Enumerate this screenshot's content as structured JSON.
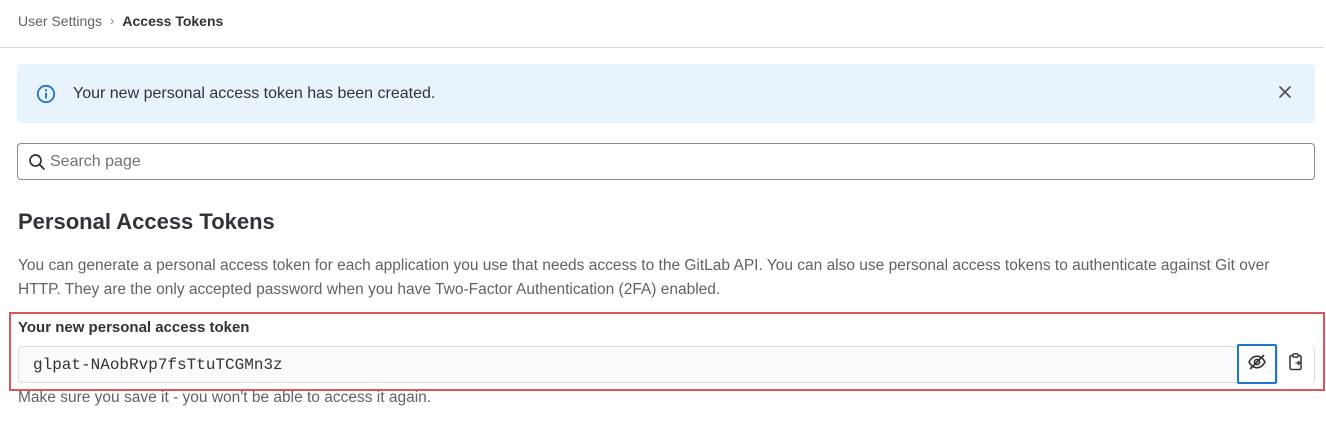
{
  "breadcrumb": {
    "parent": "User Settings",
    "separator": "›",
    "current": "Access Tokens"
  },
  "alert": {
    "message": "Your new personal access token has been created.",
    "icon": "info-icon",
    "close_icon": "close-icon",
    "color": "#e9f3fc",
    "icon_color": "#1f75cb"
  },
  "search": {
    "placeholder": "Search page",
    "value": ""
  },
  "section": {
    "title": "Personal Access Tokens",
    "description": "You can generate a personal access token for each application you use that needs access to the GitLab API. You can also use personal access tokens to authenticate against Git over HTTP. They are the only accepted password when you have Two-Factor Authentication (2FA) enabled."
  },
  "token": {
    "label": "Your new personal access token",
    "value": "glpat-NAobRvp7fsTtuTCGMn3z",
    "help": "Make sure you save it - you won't be able to access it again.",
    "toggle_icon": "eye-slash-icon",
    "copy_icon": "clipboard-icon",
    "highlight_color": "#dd5555",
    "focus_color": "#1f75cb"
  }
}
